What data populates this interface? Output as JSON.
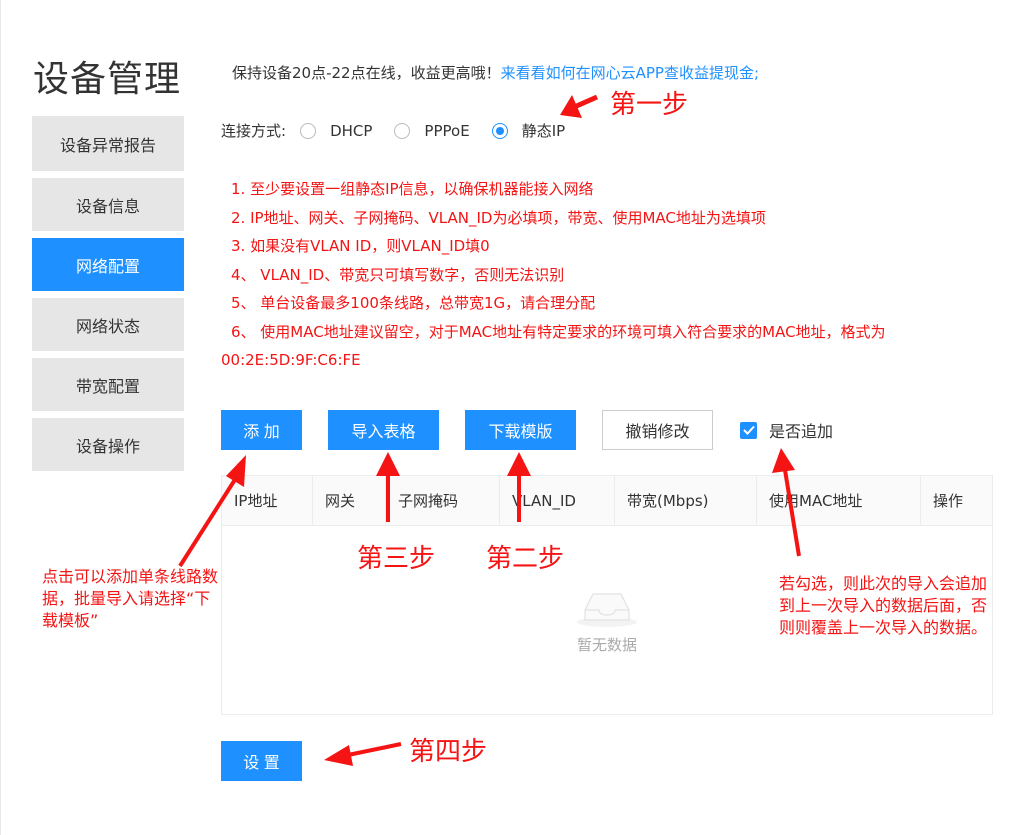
{
  "page": {
    "title": "设备管理"
  },
  "sidebar": {
    "items": [
      {
        "label": "设备异常报告",
        "active": false
      },
      {
        "label": "设备信息",
        "active": false
      },
      {
        "label": "网络配置",
        "active": true
      },
      {
        "label": "网络状态",
        "active": false
      },
      {
        "label": "带宽配置",
        "active": false
      },
      {
        "label": "设备操作",
        "active": false
      }
    ]
  },
  "promo": {
    "text": "保持设备20点-22点在线，收益更高哦！",
    "link": "来看看如何在网心云APP查收益提现金;"
  },
  "connection": {
    "label": "连接方式:",
    "options": [
      {
        "label": "DHCP",
        "selected": false
      },
      {
        "label": "PPPoE",
        "selected": false
      },
      {
        "label": "静态IP",
        "selected": true
      }
    ]
  },
  "notes": [
    "1. 至少要设置一组静态IP信息，以确保机器能接入网络",
    "2. IP地址、网关、子网掩码、VLAN_ID为必填项，带宽、使用MAC地址为选填项",
    "3. 如果没有VLAN ID，则VLAN_ID填0",
    "4、 VLAN_ID、带宽只可填写数字，否则无法识别",
    "5、 单台设备最多100条线路，总带宽1G，请合理分配",
    "6、 使用MAC地址建议留空，对于MAC地址有特定要求的环境可填入符合要求的MAC地址，格式为",
    "00:2E:5D:9F:C6:FE"
  ],
  "toolbar": {
    "add_label": "添 加",
    "import_label": "导入表格",
    "download_label": "下载模版",
    "undo_label": "撤销修改",
    "append_label": "是否追加",
    "append_checked": true
  },
  "table": {
    "columns": [
      "IP地址",
      "网关",
      "子网掩码",
      "VLAN_ID",
      "带宽(Mbps)",
      "使用MAC地址",
      "操作"
    ],
    "rows": [],
    "empty_text": "暂无数据"
  },
  "set_label": "设 置",
  "annotations": {
    "step1": "第一步",
    "step2": "第二步",
    "step3": "第三步",
    "step4": "第四步",
    "add_hint": "点击可以添加单条线路数据，批量导入请选择“下载模板”",
    "append_hint": "若勾选，则此次的导入会追加到上一次导入的数据后面，否则则覆盖上一次导入的数据。"
  },
  "colors": {
    "accent": "#1e90ff",
    "annotation": "#f41414",
    "sidebar_bg": "#e6e6e6"
  }
}
